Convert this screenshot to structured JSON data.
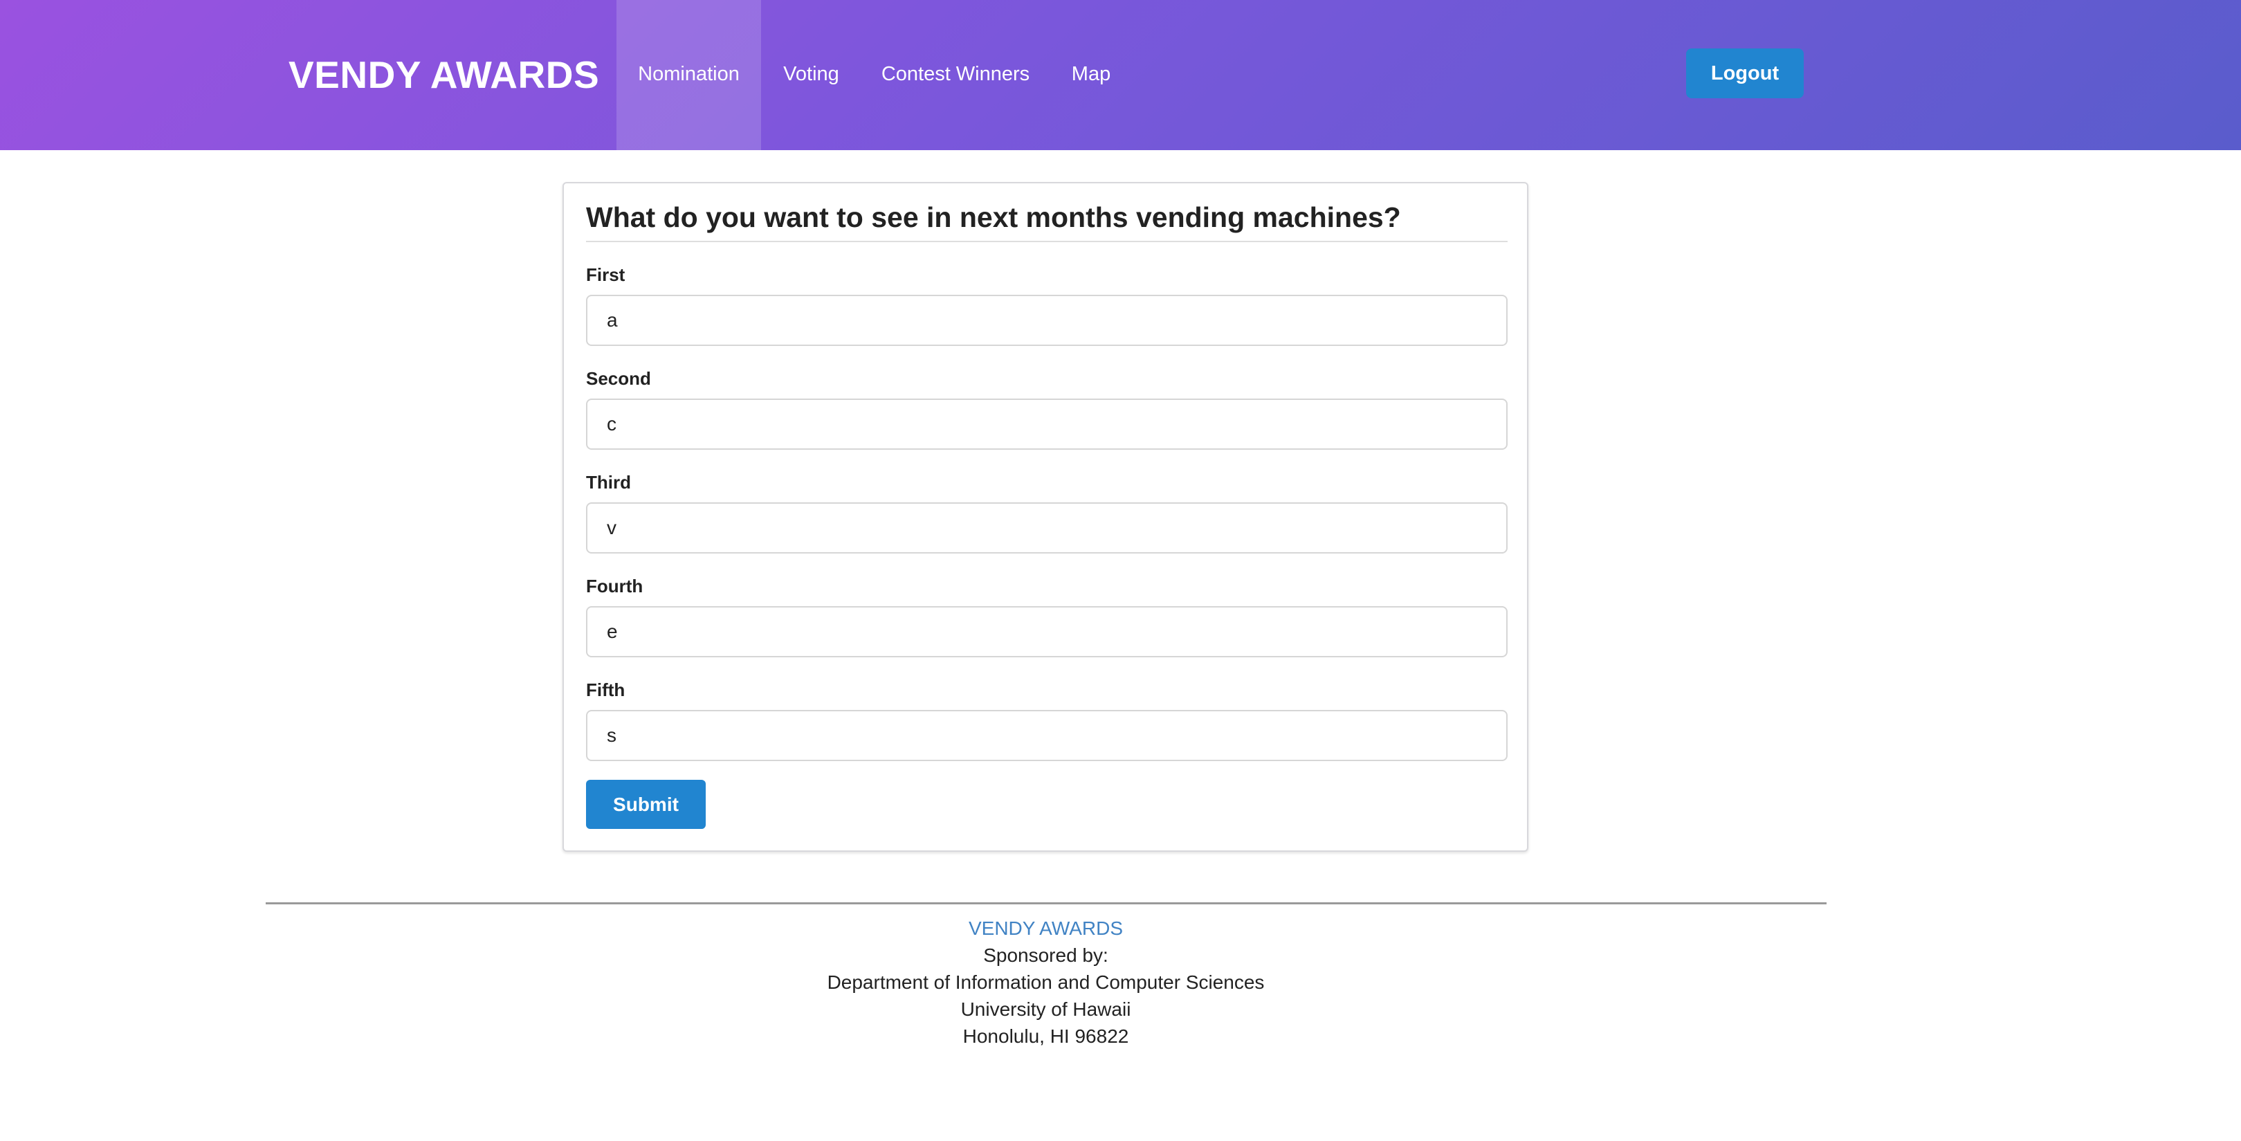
{
  "navbar": {
    "brand": "VENDY AWARDS",
    "items": [
      {
        "label": "Nomination",
        "active": true
      },
      {
        "label": "Voting",
        "active": false
      },
      {
        "label": "Contest Winners",
        "active": false
      },
      {
        "label": "Map",
        "active": false
      }
    ],
    "logout_label": "Logout"
  },
  "form": {
    "title": "What do you want to see in next months vending machines?",
    "fields": [
      {
        "label": "First",
        "value": "a"
      },
      {
        "label": "Second",
        "value": "c"
      },
      {
        "label": "Third",
        "value": "v"
      },
      {
        "label": "Fourth",
        "value": "e"
      },
      {
        "label": "Fifth",
        "value": "s"
      }
    ],
    "submit_label": "Submit"
  },
  "footer": {
    "link": "VENDY AWARDS",
    "lines": [
      "Sponsored by:",
      "Department of Information and Computer Sciences",
      "University of Hawaii",
      "Honolulu, HI 96822"
    ]
  },
  "colors": {
    "primary_button": "#2185d0",
    "nav_gradient_start": "#9a52e0",
    "nav_gradient_end": "#5a5ccc",
    "footer_link": "#4183c4"
  }
}
